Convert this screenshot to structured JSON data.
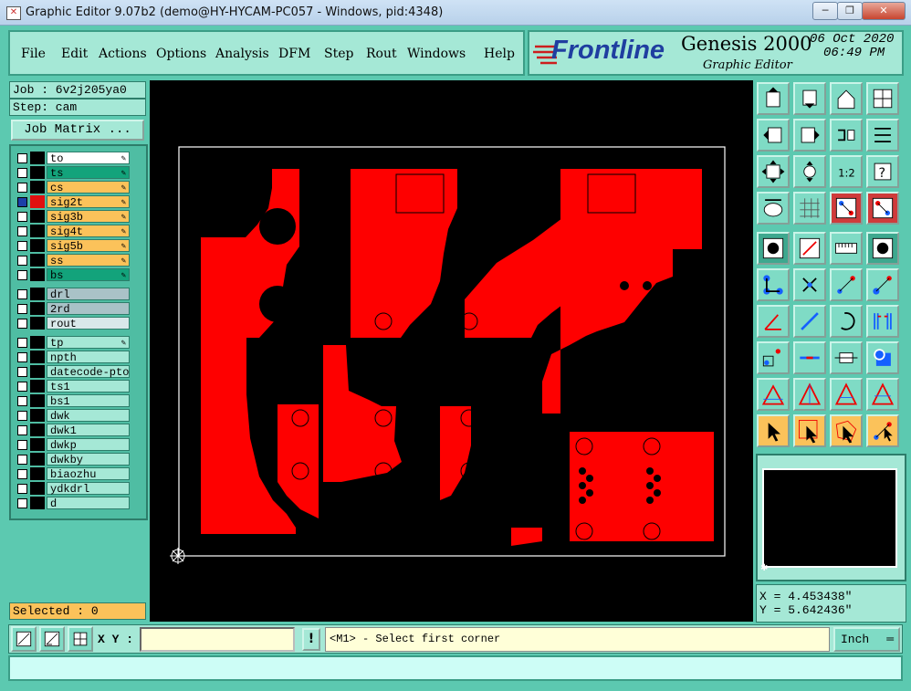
{
  "window": {
    "title": "Graphic Editor 9.07b2 (demo@HY-HYCAM-PC057 - Windows, pid:4348)",
    "minimize": "─",
    "restore": "❐",
    "close": "✕"
  },
  "menu": [
    {
      "label": "File"
    },
    {
      "label": "Edit"
    },
    {
      "label": "Actions"
    },
    {
      "label": "Options"
    },
    {
      "label": "Analysis"
    },
    {
      "label": "DFM"
    },
    {
      "label": "Step"
    },
    {
      "label": "Rout"
    },
    {
      "label": "Windows"
    },
    {
      "label": "Help"
    }
  ],
  "brand": {
    "logo": "Frontline",
    "product": "Genesis 2000",
    "subtitle": "Graphic Editor",
    "date": "06 Oct 2020",
    "time": "06:49 PM"
  },
  "job": {
    "label": "Job : 6v2j205ya0",
    "step": "Step: cam",
    "matrix_button": "Job Matrix ..."
  },
  "layers": {
    "group1": [
      {
        "name": "to",
        "color": "#ffffff",
        "editable": true,
        "active": false
      },
      {
        "name": "ts",
        "color": "#13a37b",
        "editable": true,
        "active": false
      },
      {
        "name": "cs",
        "color": "#fbc25a",
        "editable": true,
        "active": false
      },
      {
        "name": "sig2t",
        "color": "#fbc25a",
        "editable": true,
        "active": true
      },
      {
        "name": "sig3b",
        "color": "#fbc25a",
        "editable": true,
        "active": false
      },
      {
        "name": "sig4t",
        "color": "#fbc25a",
        "editable": true,
        "active": false
      },
      {
        "name": "sig5b",
        "color": "#fbc25a",
        "editable": true,
        "active": false
      },
      {
        "name": "ss",
        "color": "#fbc25a",
        "editable": true,
        "active": false
      },
      {
        "name": "bs",
        "color": "#13a37b",
        "editable": true,
        "active": false
      }
    ],
    "group2": [
      {
        "name": "drl",
        "color": "#a9c2c7"
      },
      {
        "name": "2rd",
        "color": "#a9c2c7"
      },
      {
        "name": "rout",
        "color": "#d9e8ea"
      }
    ],
    "group3": [
      {
        "name": "tp",
        "editable": true
      },
      {
        "name": "npth"
      },
      {
        "name": "datecode-pto"
      },
      {
        "name": "ts1"
      },
      {
        "name": "bs1"
      },
      {
        "name": "dwk"
      },
      {
        "name": "dwk1"
      },
      {
        "name": "dwkp"
      },
      {
        "name": "dwkby"
      },
      {
        "name": "biaozhu"
      },
      {
        "name": "ydkdrl"
      },
      {
        "name": "d"
      }
    ]
  },
  "selected": "Selected : 0",
  "coords": {
    "x": "X = 4.453438\"",
    "y": "Y = 5.642436\""
  },
  "bottom": {
    "xy_label": "X Y :",
    "xy_value": "",
    "bang": "!",
    "prompt": "<M1> - Select first corner",
    "units": "Inch"
  },
  "status_text": "",
  "colors": {
    "copper": "#fe0000",
    "panel": "#5cc9b0",
    "highlight": "#fbc25a",
    "green_layer": "#13a37b"
  }
}
